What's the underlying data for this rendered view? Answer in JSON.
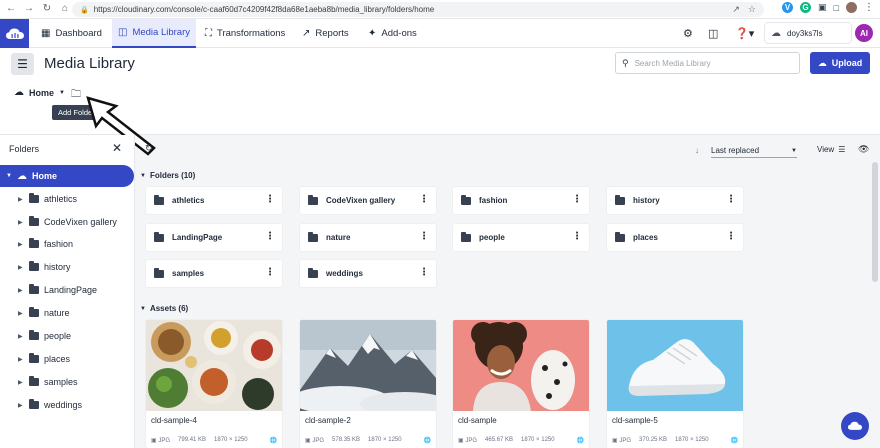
{
  "browser": {
    "url": "https://cloudinary.com/console/c-caaf60d7c4209f42f8da68e1aeba8b/media_library/folders/home"
  },
  "nav": {
    "items": [
      {
        "label": "Dashboard",
        "icon": "dashboard-icon"
      },
      {
        "label": "Media Library",
        "icon": "media-library-icon"
      },
      {
        "label": "Transformations",
        "icon": "transformations-icon"
      },
      {
        "label": "Reports",
        "icon": "reports-icon"
      },
      {
        "label": "Add-ons",
        "icon": "puzzle-icon"
      }
    ],
    "cloud_name": "doy3ks7ls",
    "avatar_initials": "AI"
  },
  "page": {
    "title": "Media Library",
    "search_placeholder": "Search Media Library",
    "upload_label": "Upload",
    "breadcrumb": "Home",
    "tooltip": "Add Folder"
  },
  "sidebar": {
    "title": "Folders",
    "root": "Home",
    "folders": [
      "athletics",
      "CodeVixen gallery",
      "fashion",
      "history",
      "LandingPage",
      "nature",
      "people",
      "places",
      "samples",
      "weddings"
    ]
  },
  "toolbar": {
    "sort": "Last replaced",
    "view_label": "View"
  },
  "folders_section": {
    "label": "Folders (10)",
    "folders": [
      "athletics",
      "CodeVixen gallery",
      "fashion",
      "history",
      "LandingPage",
      "nature",
      "people",
      "places",
      "samples",
      "weddings"
    ]
  },
  "assets_section": {
    "label": "Assets (6)",
    "assets": [
      {
        "name": "cld-sample-4",
        "format": "JPG",
        "size": "799.41 KB",
        "dimensions": "1870 × 1250"
      },
      {
        "name": "cld-sample-2",
        "format": "JPG",
        "size": "578.35 KB",
        "dimensions": "1870 × 1250"
      },
      {
        "name": "cld-sample",
        "format": "JPG",
        "size": "465.67 KB",
        "dimensions": "1870 × 1250"
      },
      {
        "name": "cld-sample-5",
        "format": "JPG",
        "size": "370.25 KB",
        "dimensions": "1870 × 1250"
      }
    ]
  },
  "colors": {
    "brand": "#3448c5",
    "brand_light": "#e8ebfb"
  }
}
